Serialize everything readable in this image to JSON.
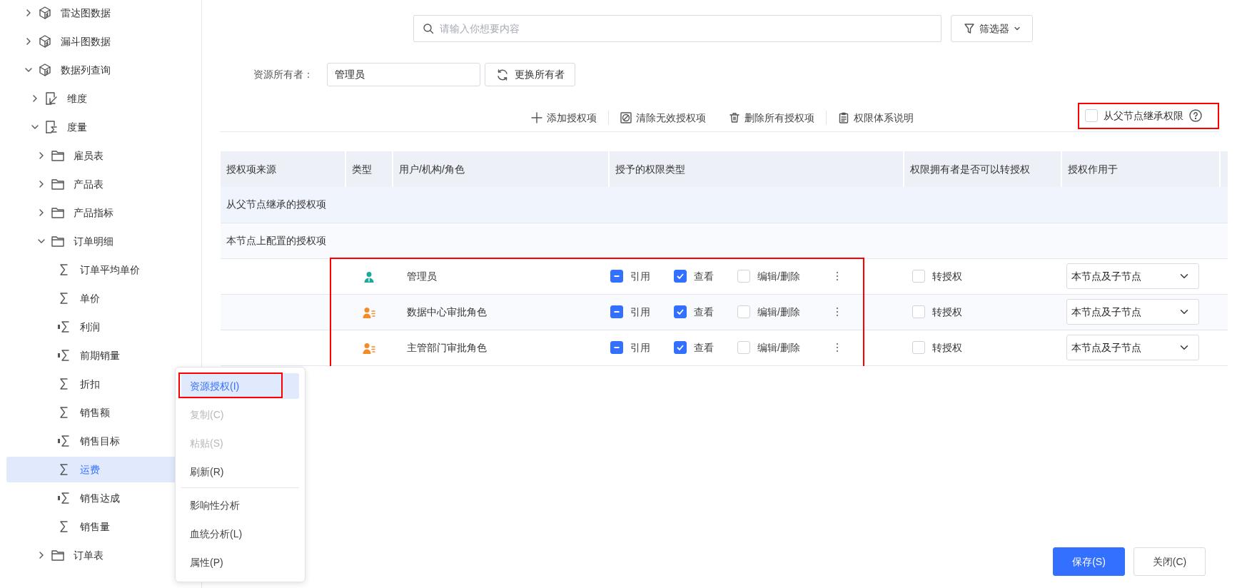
{
  "tree": [
    {
      "kind": "cube",
      "label": "雷达图数据",
      "expanded": false,
      "selected": false
    },
    {
      "kind": "cube",
      "label": "漏斗图数据",
      "expanded": false,
      "selected": false
    },
    {
      "kind": "cube",
      "label": "数据列查询",
      "expanded": true,
      "selected": false,
      "children": [
        {
          "kind": "dimension",
          "label": "维度",
          "expanded": false,
          "selected": false
        },
        {
          "kind": "measure",
          "label": "度量",
          "expanded": true,
          "selected": false,
          "children": [
            {
              "kind": "folder",
              "label": "雇员表",
              "expanded": false,
              "selected": false
            },
            {
              "kind": "folder",
              "label": "产品表",
              "expanded": false,
              "selected": false
            },
            {
              "kind": "folder",
              "label": "产品指标",
              "expanded": false,
              "selected": false
            },
            {
              "kind": "folder",
              "label": "订单明细",
              "expanded": true,
              "selected": false,
              "children": [
                {
                  "kind": "sum",
                  "label": "订单平均单价",
                  "selected": false
                },
                {
                  "kind": "sum",
                  "label": "单价",
                  "selected": false
                },
                {
                  "kind": "bar-sum",
                  "label": "利润",
                  "selected": false
                },
                {
                  "kind": "bar-sum",
                  "label": "前期销量",
                  "selected": false
                },
                {
                  "kind": "sum",
                  "label": "折扣",
                  "selected": false
                },
                {
                  "kind": "sum",
                  "label": "销售额",
                  "selected": false
                },
                {
                  "kind": "bar-sum",
                  "label": "销售目标",
                  "selected": false
                },
                {
                  "kind": "sum",
                  "label": "运费",
                  "selected": true
                },
                {
                  "kind": "bar-sum",
                  "label": "销售达成",
                  "selected": false
                },
                {
                  "kind": "sum",
                  "label": "销售量",
                  "selected": false
                }
              ]
            },
            {
              "kind": "folder",
              "label": "订单表",
              "expanded": false,
              "selected": false
            }
          ]
        }
      ]
    }
  ],
  "context_menu": {
    "groups": [
      [
        {
          "label": "资源授权(I)",
          "selected": true,
          "disabled": false
        },
        {
          "label": "复制(C)",
          "selected": false,
          "disabled": true
        },
        {
          "label": "粘贴(S)",
          "selected": false,
          "disabled": true
        },
        {
          "label": "刷新(R)",
          "selected": false,
          "disabled": false
        }
      ],
      [
        {
          "label": "影响性分析",
          "selected": false,
          "disabled": false
        },
        {
          "label": "血统分析(L)",
          "selected": false,
          "disabled": false
        },
        {
          "label": "属性(P)",
          "selected": false,
          "disabled": false
        }
      ]
    ]
  },
  "search": {
    "placeholder": "请输入你想要内容"
  },
  "filter_button": "筛选器",
  "owner": {
    "label": "资源所有者：",
    "value": "管理员",
    "change_button": "更换所有者"
  },
  "toolbar": {
    "groups": [
      [
        {
          "kind": "add",
          "label": "添加授权项"
        }
      ],
      [
        {
          "kind": "clear",
          "label": "清除无效授权项"
        },
        {
          "kind": "delete",
          "label": "删除所有授权项"
        }
      ],
      [
        {
          "kind": "doc",
          "label": "权限体系说明"
        }
      ]
    ]
  },
  "inherit": {
    "label": "从父节点继承权限",
    "checked": false
  },
  "table": {
    "columns": [
      "授权项来源",
      "类型",
      "用户/机构/角色",
      "授予的权限类型",
      "权限拥有者是否可以转授权",
      "授权作用于"
    ],
    "sections": [
      {
        "title": "从父节点继承的授权项"
      },
      {
        "title": "本节点上配置的授权项",
        "rows": [
          {
            "kind": "user",
            "name": "管理员",
            "permissions": [
              {
                "label": "引用",
                "checked": false,
                "indeterminate": true
              },
              {
                "label": "查看",
                "checked": true,
                "indeterminate": false
              },
              {
                "label": "编辑/删除",
                "checked": false,
                "indeterminate": false
              }
            ],
            "regrant": {
              "label": "转授权",
              "checked": false
            },
            "scope": "本节点及子节点"
          },
          {
            "kind": "role",
            "name": "数据中心审批角色",
            "permissions": [
              {
                "label": "引用",
                "checked": false,
                "indeterminate": true
              },
              {
                "label": "查看",
                "checked": true,
                "indeterminate": false
              },
              {
                "label": "编辑/删除",
                "checked": false,
                "indeterminate": false
              }
            ],
            "regrant": {
              "label": "转授权",
              "checked": false
            },
            "scope": "本节点及子节点"
          },
          {
            "kind": "role",
            "name": "主管部门审批角色",
            "permissions": [
              {
                "label": "引用",
                "checked": false,
                "indeterminate": true
              },
              {
                "label": "查看",
                "checked": true,
                "indeterminate": false
              },
              {
                "label": "编辑/删除",
                "checked": false,
                "indeterminate": false
              }
            ],
            "regrant": {
              "label": "转授权",
              "checked": false
            },
            "scope": "本节点及子节点"
          }
        ]
      }
    ]
  },
  "buttons": [
    {
      "kind": "primary",
      "label": "保存(S)"
    },
    {
      "kind": "secondary",
      "label": "关闭(C)"
    }
  ]
}
